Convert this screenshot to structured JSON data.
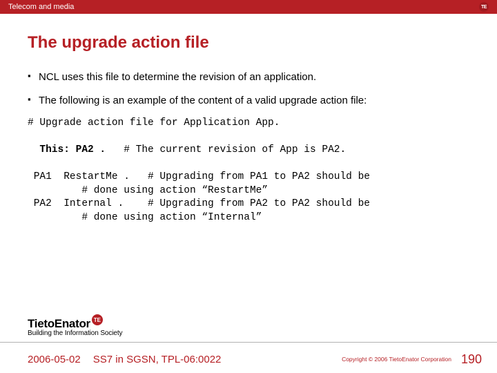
{
  "topbar": {
    "section": "Telecom and media",
    "badge": "TE"
  },
  "title": "The upgrade action file",
  "bullets": [
    "NCL uses this file to determine the revision of an application.",
    "The following is an example of the content of a valid upgrade action file:"
  ],
  "code": {
    "line0": "# Upgrade action file for Application App.",
    "thisLabel": "  This: PA2 .",
    "thisComment": "   # The current revision of App is PA2.",
    "l3": " PA1  RestartMe .   # Upgrading from PA1 to PA2 should be",
    "l4": "         # done using action “RestartMe”",
    "l5": " PA2  Internal .    # Upgrading from PA2 to PA2 should be",
    "l6": "         # done using action “Internal”"
  },
  "logo": {
    "name": "TietoEnator",
    "badge": "TE",
    "tagline": "Building the Information Society"
  },
  "footer": {
    "date": "2006-05-02",
    "doc": "SS7 in SGSN, TPL-06:0022",
    "copyright": "Copyright © 2006 TietoEnator Corporation",
    "page": "190"
  }
}
